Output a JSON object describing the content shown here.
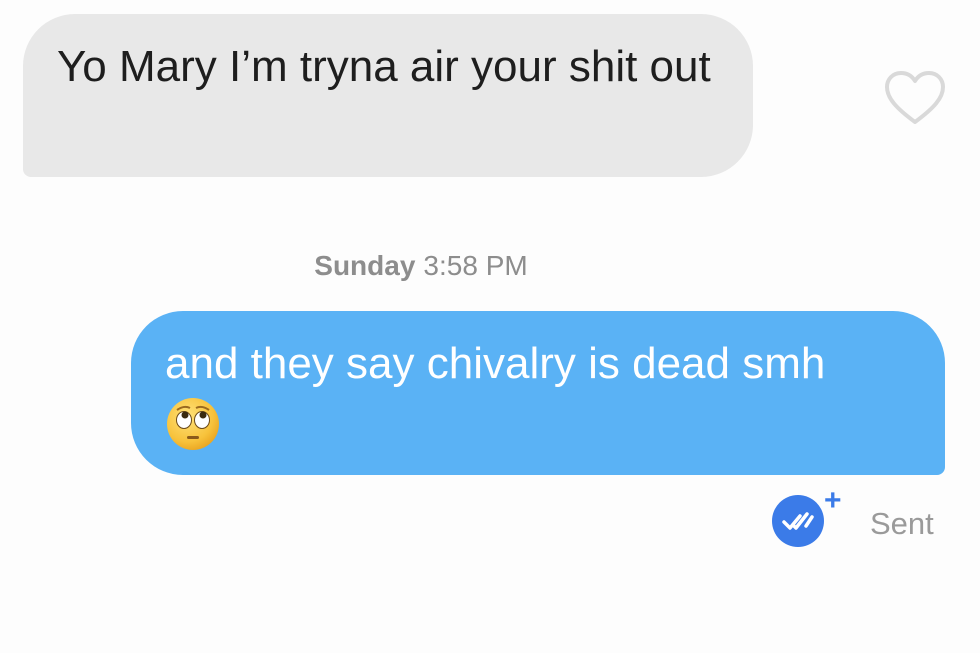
{
  "messages": [
    {
      "direction": "received",
      "text": "Yo Mary I’m tryna air your shit out"
    },
    {
      "direction": "sent",
      "text": "and they say chivalry is dead smh",
      "emoji": "face-with-rolling-eyes"
    }
  ],
  "timestamp": {
    "day": "Sunday",
    "time": "3:58 PM"
  },
  "sent_status": {
    "plus": "+",
    "label": "Sent",
    "icon": "double-check-icon"
  },
  "colors": {
    "received_bubble": "#e8e8e8",
    "sent_bubble": "#5ab2f5",
    "receipt_blue": "#3b7be8",
    "meta_text": "#8d8d8d"
  }
}
